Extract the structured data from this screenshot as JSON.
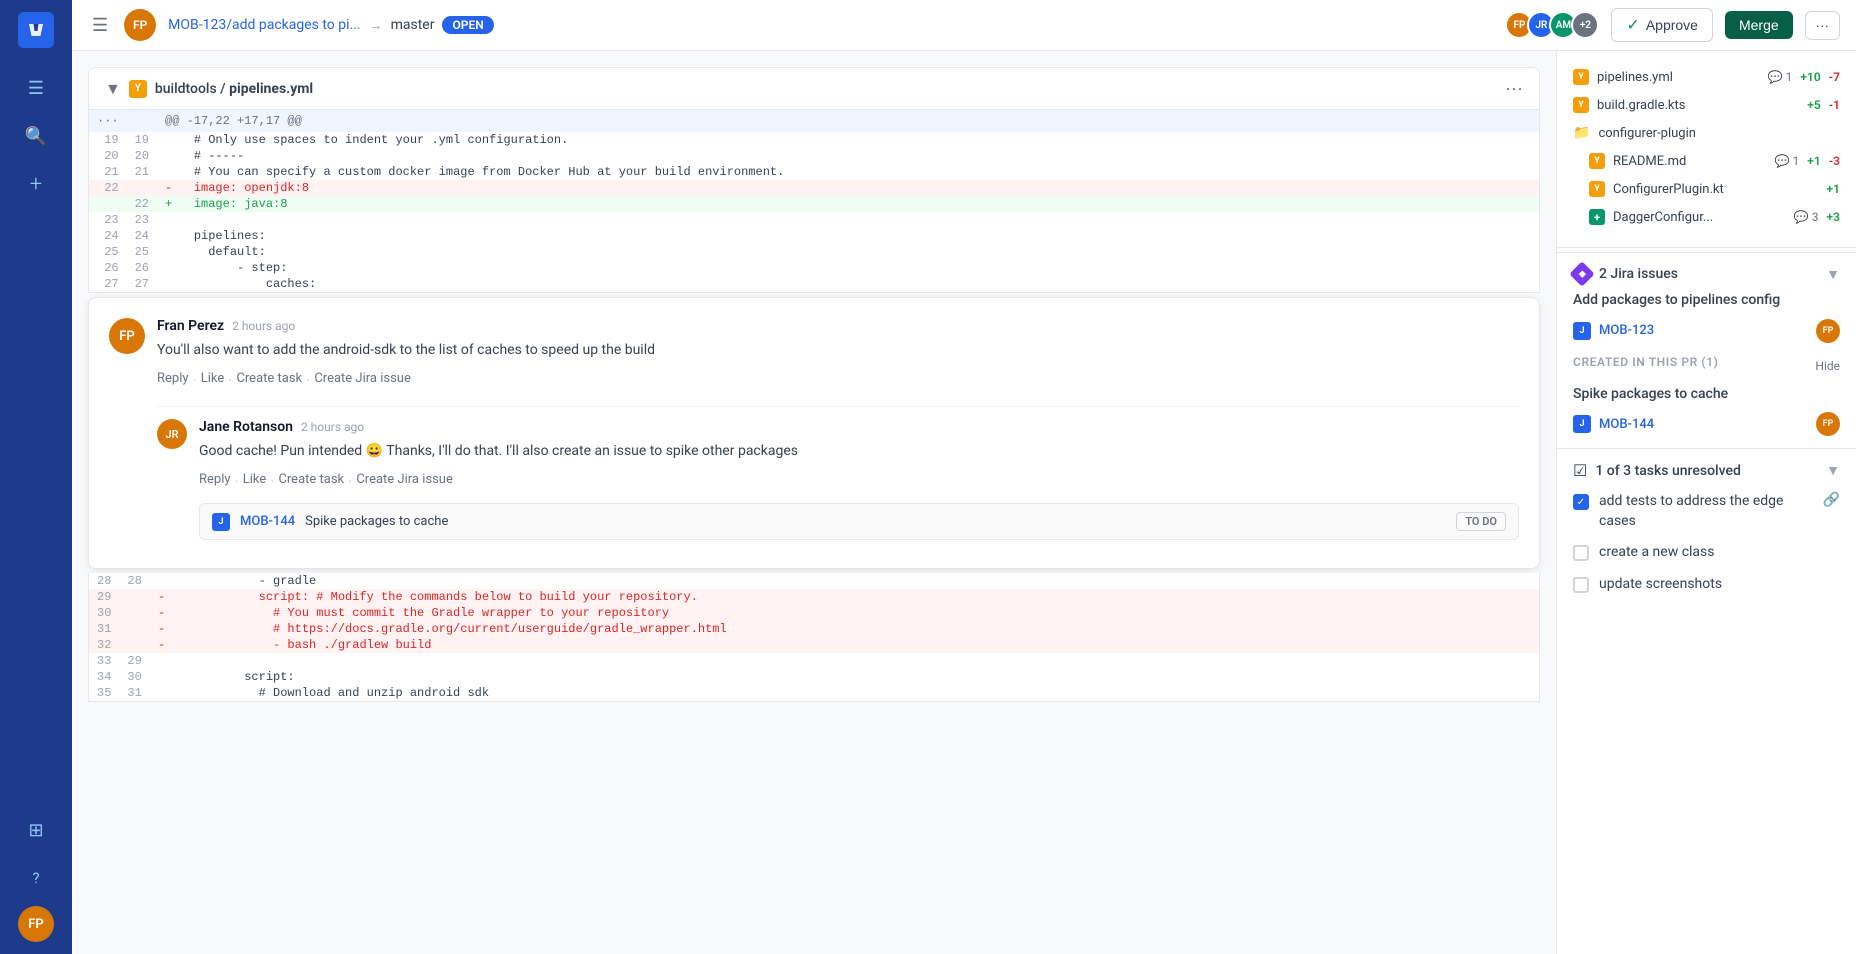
{
  "sidebar": {
    "logo_symbol": "⌂",
    "icons": [
      {
        "name": "menu-icon",
        "symbol": "☰"
      },
      {
        "name": "search-icon",
        "symbol": "🔍"
      },
      {
        "name": "create-icon",
        "symbol": "+"
      },
      {
        "name": "apps-icon",
        "symbol": "⊞"
      },
      {
        "name": "help-icon",
        "symbol": "?"
      }
    ],
    "avatar_initials": "FP"
  },
  "topbar": {
    "avatar_initials": "FP",
    "branch_name": "MOB-123/add packages to pi...",
    "arrow": "→",
    "target_branch": "master",
    "status_badge": "OPEN",
    "approve_label": "Approve",
    "merge_label": "Merge",
    "reviewer_count": "+2"
  },
  "file_header": {
    "path_prefix": "buildtools /",
    "file_name": "pipelines.yml",
    "more_icon": "···"
  },
  "diff": {
    "meta_line": "@@ -17,22 +17,17 @@",
    "lines": [
      {
        "old_num": "19",
        "new_num": "19",
        "type": "context",
        "content": "    # Only use spaces to indent your .yml configuration."
      },
      {
        "old_num": "20",
        "new_num": "20",
        "type": "context",
        "content": "    # -----"
      },
      {
        "old_num": "21",
        "new_num": "21",
        "type": "context",
        "content": "    # You can specify a custom docker image from Docker Hub at your build environment."
      },
      {
        "old_num": "22",
        "new_num": "",
        "type": "removed",
        "content": "- image: openjdk:8"
      },
      {
        "old_num": "",
        "new_num": "22",
        "type": "added",
        "content": "+ image: java:8"
      },
      {
        "old_num": "23",
        "new_num": "23",
        "type": "context",
        "content": ""
      },
      {
        "old_num": "24",
        "new_num": "24",
        "type": "context",
        "content": "    pipelines:"
      },
      {
        "old_num": "25",
        "new_num": "25",
        "type": "context",
        "content": "      default:"
      },
      {
        "old_num": "26",
        "new_num": "26",
        "type": "context",
        "content": "          - step:"
      },
      {
        "old_num": "27",
        "new_num": "27",
        "type": "context",
        "content": "              caches:"
      }
    ],
    "lines_after": [
      {
        "old_num": "28",
        "new_num": "28",
        "type": "context",
        "content": "              - gradle"
      },
      {
        "old_num": "29",
        "new_num": "",
        "type": "removed",
        "content": "            script: # Modify the commands below to build your repository."
      },
      {
        "old_num": "30",
        "new_num": "",
        "type": "removed",
        "content": "              # You must commit the Gradle wrapper to your repository"
      },
      {
        "old_num": "31",
        "new_num": "",
        "type": "removed",
        "content": "              # https://docs.gradle.org/current/userguide/gradle_wrapper.html"
      },
      {
        "old_num": "32",
        "new_num": "",
        "type": "removed",
        "content": "              - bash ./gradlew build"
      },
      {
        "old_num": "33",
        "new_num": "29",
        "type": "context",
        "content": ""
      },
      {
        "old_num": "34",
        "new_num": "30",
        "type": "context",
        "content": "            script:"
      },
      {
        "old_num": "35",
        "new_num": "31",
        "type": "context",
        "content": "              # Download and unzip android sdk"
      }
    ]
  },
  "comment": {
    "author": "Fran Perez",
    "time": "2 hours ago",
    "text": "You'll also want to add the android-sdk to the list of caches to speed up the build",
    "actions": [
      "Reply",
      "Like",
      "Create task",
      "Create Jira issue"
    ],
    "avatar_initials": "FP"
  },
  "nested_comment": {
    "author": "Jane Rotanson",
    "time": "2 hours ago",
    "text": "Good cache! Pun intended 😀 Thanks, I'll do that. I'll also create an issue to spike other packages",
    "actions": [
      "Reply",
      "Like",
      "Create task",
      "Create Jira issue"
    ],
    "avatar_initials": "JR",
    "jira_task": {
      "icon_text": "J",
      "id": "MOB-144",
      "name": "Spike packages to cache",
      "status": "TO DO"
    }
  },
  "right_panel": {
    "files": [
      {
        "icon_type": "yellow",
        "name": "pipelines.yml",
        "comment_count": "1",
        "plus": "+10",
        "minus": "-7"
      },
      {
        "icon_type": "yellow",
        "name": "build.gradle.kts",
        "comment_count": "",
        "plus": "+5",
        "minus": "-1"
      },
      {
        "icon_type": "folder",
        "name": "configurer-plugin",
        "comment_count": "",
        "plus": "",
        "minus": ""
      },
      {
        "icon_type": "yellow",
        "name": "README.md",
        "comment_count": "1",
        "plus": "+1",
        "minus": "-3"
      },
      {
        "icon_type": "yellow",
        "name": "ConfigurerPlugin.kt",
        "comment_count": "",
        "plus": "+1",
        "minus": ""
      },
      {
        "icon_type": "green-plus",
        "name": "DaggerConfigur...",
        "comment_count": "3",
        "plus": "+3",
        "minus": ""
      }
    ],
    "jira_section": {
      "title": "2 Jira issues",
      "issues": [
        {
          "title": "Add packages to pipelines config",
          "id": "MOB-123",
          "avatar_initials": "FP"
        }
      ],
      "created_label": "CREATED IN THIS PR (1)",
      "hide_label": "Hide",
      "spike_issue": {
        "title": "Spike packages to cache",
        "id": "MOB-144",
        "avatar_initials": "FP"
      }
    },
    "tasks_section": {
      "title": "1 of 3 tasks unresolved",
      "tasks": [
        {
          "text": "add tests to address the edge cases",
          "checked": true,
          "has_link": true
        },
        {
          "text": "create a new class",
          "checked": false,
          "has_link": false
        },
        {
          "text": "update screenshots",
          "checked": false,
          "has_link": false
        }
      ]
    }
  }
}
